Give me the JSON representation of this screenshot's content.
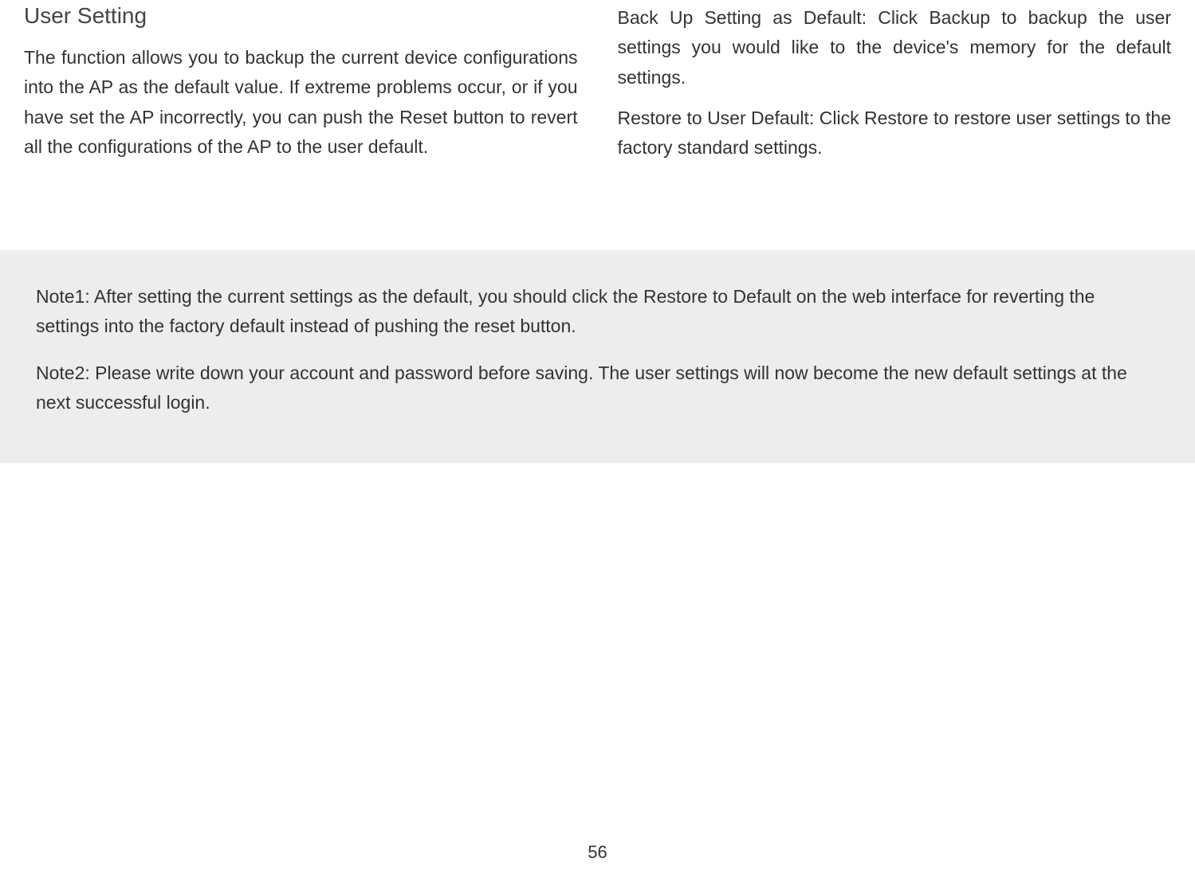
{
  "left_column": {
    "heading": "User Setting",
    "paragraph": "The function allows you to backup the current device configurations into the AP as the default value. If extreme problems occur, or if you have set the AP incorrectly, you can push the Reset button to revert all the configurations of the AP to the user default."
  },
  "right_column": {
    "paragraph1": "Back Up Setting as Default:  Click Backup to backup the user settings you would like to the device's memory for the default settings.",
    "paragraph2": "Restore to User Default: Click Restore to restore user settings to the factory standard settings."
  },
  "notes": {
    "note1": "Note1: After setting the current settings as the default, you should click the Restore to Default on the web interface for reverting the settings into the factory default instead of pushing the reset button.",
    "note2": "Note2: Please write down your account and password before saving. The user settings will now become the new default settings at the next successful login."
  },
  "page_number": "56"
}
